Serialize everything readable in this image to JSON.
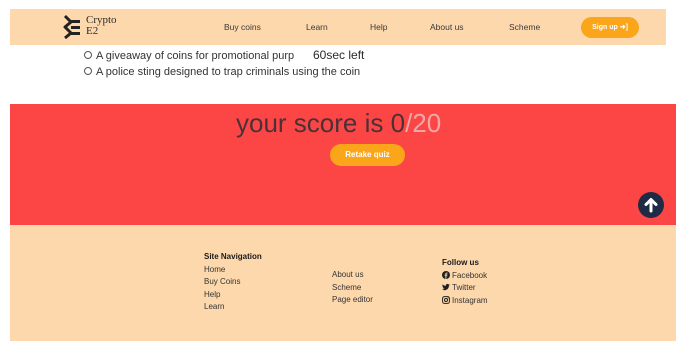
{
  "header": {
    "logo_line1": "Crypto",
    "logo_line2": "E2",
    "nav": [
      {
        "label": "Buy coins"
      },
      {
        "label": "Learn"
      },
      {
        "label": "Help"
      },
      {
        "label": "About us"
      },
      {
        "label": "Scheme"
      }
    ],
    "signup_label": "Sign up ➜]"
  },
  "quiz": {
    "options": [
      {
        "label": "A giveaway of coins for promotional purp"
      },
      {
        "label": "A police sting designed to trap criminals using the coin"
      }
    ],
    "timer": "60sec left"
  },
  "score": {
    "prefix": "your score is ",
    "value": "0",
    "total": "/20",
    "retake_label": "Retake quiz"
  },
  "footer": {
    "site_nav": {
      "title": "Site Navigation",
      "links": [
        "Home",
        "Buy Coins",
        "Help",
        "Learn"
      ]
    },
    "more_links": [
      "About us",
      "Scheme",
      "Page editor"
    ],
    "follow": {
      "title": "Follow us",
      "links": [
        "Facebook",
        "Twitter",
        "Instagram"
      ]
    }
  },
  "colors": {
    "header_bg": "#fdd8ac",
    "accent": "#fba51a",
    "score_bg": "#fc4646",
    "back_to_top": "#1f2b44"
  }
}
